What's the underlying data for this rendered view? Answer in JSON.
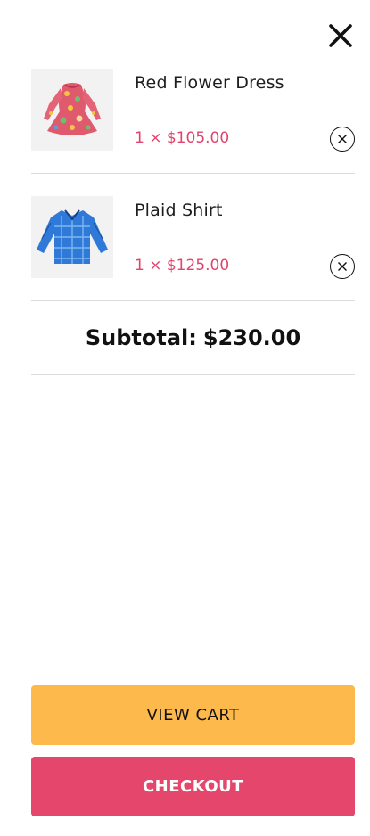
{
  "cart": {
    "items": [
      {
        "name": "Red Flower Dress",
        "price_line": "1 × $105.00",
        "image_icon": "red-floral-dress-image"
      },
      {
        "name": "Plaid Shirt",
        "price_line": "1 × $125.00",
        "image_icon": "blue-plaid-shirt-image"
      }
    ],
    "subtotal_label": "Subtotal:",
    "subtotal_value": "$230.00",
    "view_cart_label": "VIEW CART",
    "checkout_label": "CHECKOUT"
  },
  "icons": {
    "close": "close-icon",
    "remove": "remove-circle-x-icon"
  },
  "colors": {
    "price": "#e2436e",
    "view_cart_bg": "#fdb94c",
    "checkout_bg": "#e5466b",
    "divider": "#dcdcdc"
  }
}
